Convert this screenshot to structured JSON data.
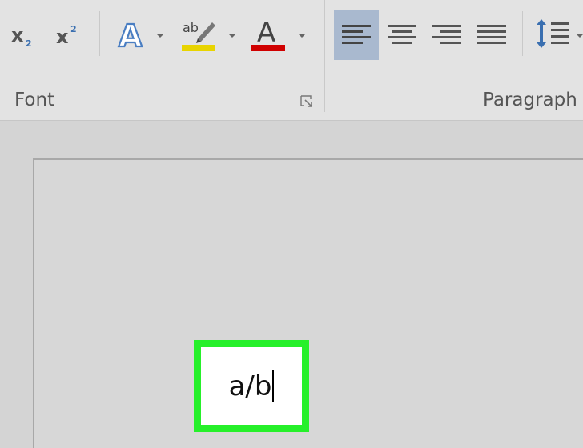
{
  "ribbon": {
    "font_group": {
      "label": "Font",
      "buttons": [
        {
          "name": "subscript",
          "icon": "subscript-icon"
        },
        {
          "name": "superscript",
          "icon": "superscript-icon"
        },
        {
          "name": "text-effects",
          "icon": "text-effects-icon"
        },
        {
          "name": "highlight",
          "icon": "highlight-pen-icon",
          "color": "#e8d400"
        },
        {
          "name": "font-color",
          "icon": "font-color-icon",
          "color": "#d00000"
        }
      ]
    },
    "paragraph_group": {
      "label": "Paragraph",
      "buttons": [
        {
          "name": "align-left",
          "icon": "align-left-icon",
          "active": true
        },
        {
          "name": "align-center",
          "icon": "align-center-icon"
        },
        {
          "name": "align-right",
          "icon": "align-right-icon"
        },
        {
          "name": "justify",
          "icon": "justify-icon"
        },
        {
          "name": "line-spacing",
          "icon": "line-spacing-icon"
        }
      ]
    }
  },
  "document": {
    "text": "a/b",
    "highlight_color": "#26f02a"
  }
}
